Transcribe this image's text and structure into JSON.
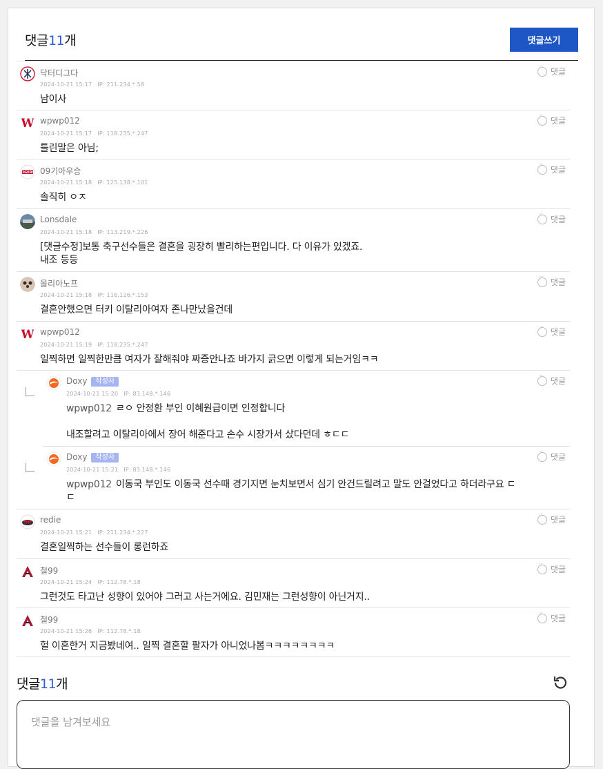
{
  "header": {
    "title_prefix": "댓글",
    "count": "11",
    "title_suffix": "개",
    "write_button": "댓글쓰기"
  },
  "reply_label": "댓글",
  "author_badge": "작성자",
  "comments": [
    {
      "nick": "닥터디그다",
      "time": "2024-10-21 15:17",
      "ip": "IP: 211.234.*.58",
      "text": "남이사",
      "avatar": "yankees-logo-icon"
    },
    {
      "nick": "wpwp012",
      "time": "2024-10-21 15:17",
      "ip": "IP: 118.235.*.247",
      "text": "틀린말은 아님;",
      "avatar": "nationals-logo-icon"
    },
    {
      "nick": "09기아우승",
      "time": "2024-10-21 15:18",
      "ip": "IP: 125.138.*.101",
      "text": "솔직히 ㅇㅈ",
      "avatar": "tigers-logo-icon"
    },
    {
      "nick": "Lonsdale",
      "time": "2024-10-21 15:18",
      "ip": "IP: 113.219.*.226",
      "text": "[댓글수정]보통 축구선수들은 결혼을 굉장히 빨리하는편입니다. 다 이유가 있겠죠.\n내조 등등",
      "avatar": "stadium-photo-icon"
    },
    {
      "nick": "올리아노프",
      "time": "2024-10-21 15:18",
      "ip": "IP: 116.126.*.153",
      "text": "결혼안했으면 터키 이탈리아여자 존나만났을건데",
      "avatar": "panda-avatar-icon"
    },
    {
      "nick": "wpwp012",
      "time": "2024-10-21 15:19",
      "ip": "IP: 118.235.*.247",
      "text": "일찍하면 일찍한만큼 여자가 잘해줘야 짜증안나죠 바가지 긁으면 이렇게 되는거임ㅋㅋ",
      "avatar": "nationals-logo-icon"
    }
  ],
  "replies": [
    {
      "nick": "Doxy",
      "time": "2024-10-21 15:20",
      "ip": "IP: 83.148.*.146",
      "mention": "wpwp012",
      "text": "ㄹㅇ 안정환 부인 이혜원급이면 인정합니다\n\n내조할려고 이탈리아에서 장어 해준다고 손수 시장가서 샀다던데 ㅎㄷㄷ",
      "avatar": "swirl-logo-icon"
    },
    {
      "nick": "Doxy",
      "time": "2024-10-21 15:21",
      "ip": "IP: 83.148.*.146",
      "mention": "wpwp012",
      "text": "이동국 부인도 이동국 선수때 경기지면 눈치보면서 심기 안건드릴려고 말도 안걸었다고 하더라구요 ㄷ\nㄷ",
      "avatar": "swirl-logo-icon"
    }
  ],
  "comments_after": [
    {
      "nick": "redie",
      "time": "2024-10-21 15:21",
      "ip": "IP: 211.234.*.227",
      "text": "결혼일찍하는 선수들이 롱런하죠",
      "avatar": "racecar-avatar-icon"
    },
    {
      "nick": "철99",
      "time": "2024-10-21 15:24",
      "ip": "IP: 112.78.*.18",
      "text": "그런것도 타고난 성향이 있어야 그러고 사는거에요. 김민재는 그런성향이 아닌거지..",
      "avatar": "diamondbacks-logo-icon"
    },
    {
      "nick": "철99",
      "time": "2024-10-21 15:26",
      "ip": "IP: 112.78.*.18",
      "text": "헐 이혼한거 지금봤네여.. 일찍 결혼할 팔자가 아니었나봄ㅋㅋㅋㅋㅋㅋㅋㅋ",
      "avatar": "diamondbacks-logo-icon"
    }
  ],
  "footer": {
    "title_prefix": "댓글",
    "count": "11",
    "title_suffix": "개",
    "placeholder": "댓글을 남겨보세요",
    "refresh_icon": "refresh-icon"
  },
  "colors": {
    "accent": "#1e56c6",
    "count": "#2d5bd3",
    "badge": "#a7b4f2"
  }
}
